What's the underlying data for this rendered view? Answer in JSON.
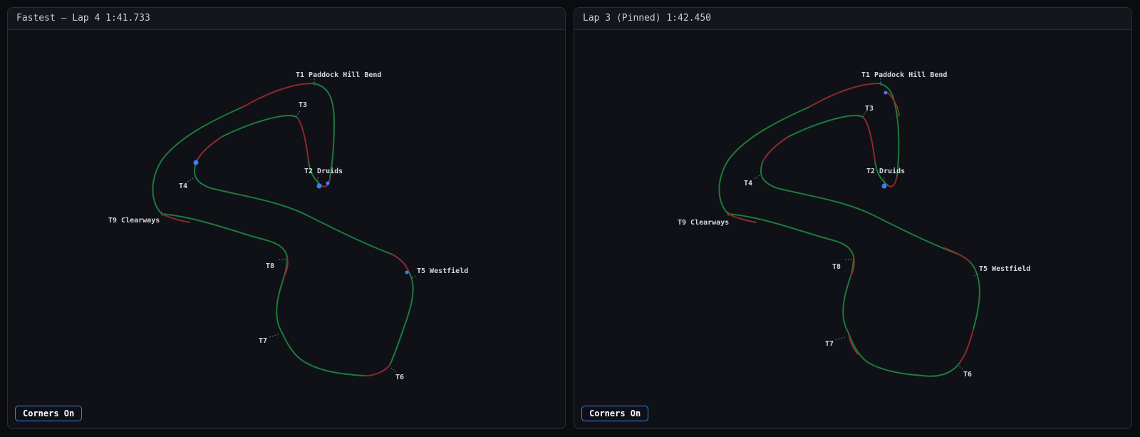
{
  "panels": [
    {
      "title": "Fastest — Lap 4 1:41.733",
      "toggle_label": "Corners On",
      "corners": [
        "T1 Paddock Hill Bend",
        "T2 Druids",
        "T3",
        "T4",
        "T5 Westfield",
        "T6",
        "T7",
        "T8",
        "T9 Clearways"
      ]
    },
    {
      "title": "Lap 3 (Pinned) 1:42.450",
      "toggle_label": "Corners On",
      "corners": [
        "T1 Paddock Hill Bend",
        "T2 Druids",
        "T3",
        "T4",
        "T5 Westfield",
        "T6",
        "T7",
        "T8",
        "T9 Clearways"
      ]
    }
  ],
  "colors": {
    "faster": "#1d7a3a",
    "slower": "#8a2b2b",
    "marker": "#3d7ef5",
    "label": "#d6d8de",
    "accent": "#3d7ef5"
  }
}
